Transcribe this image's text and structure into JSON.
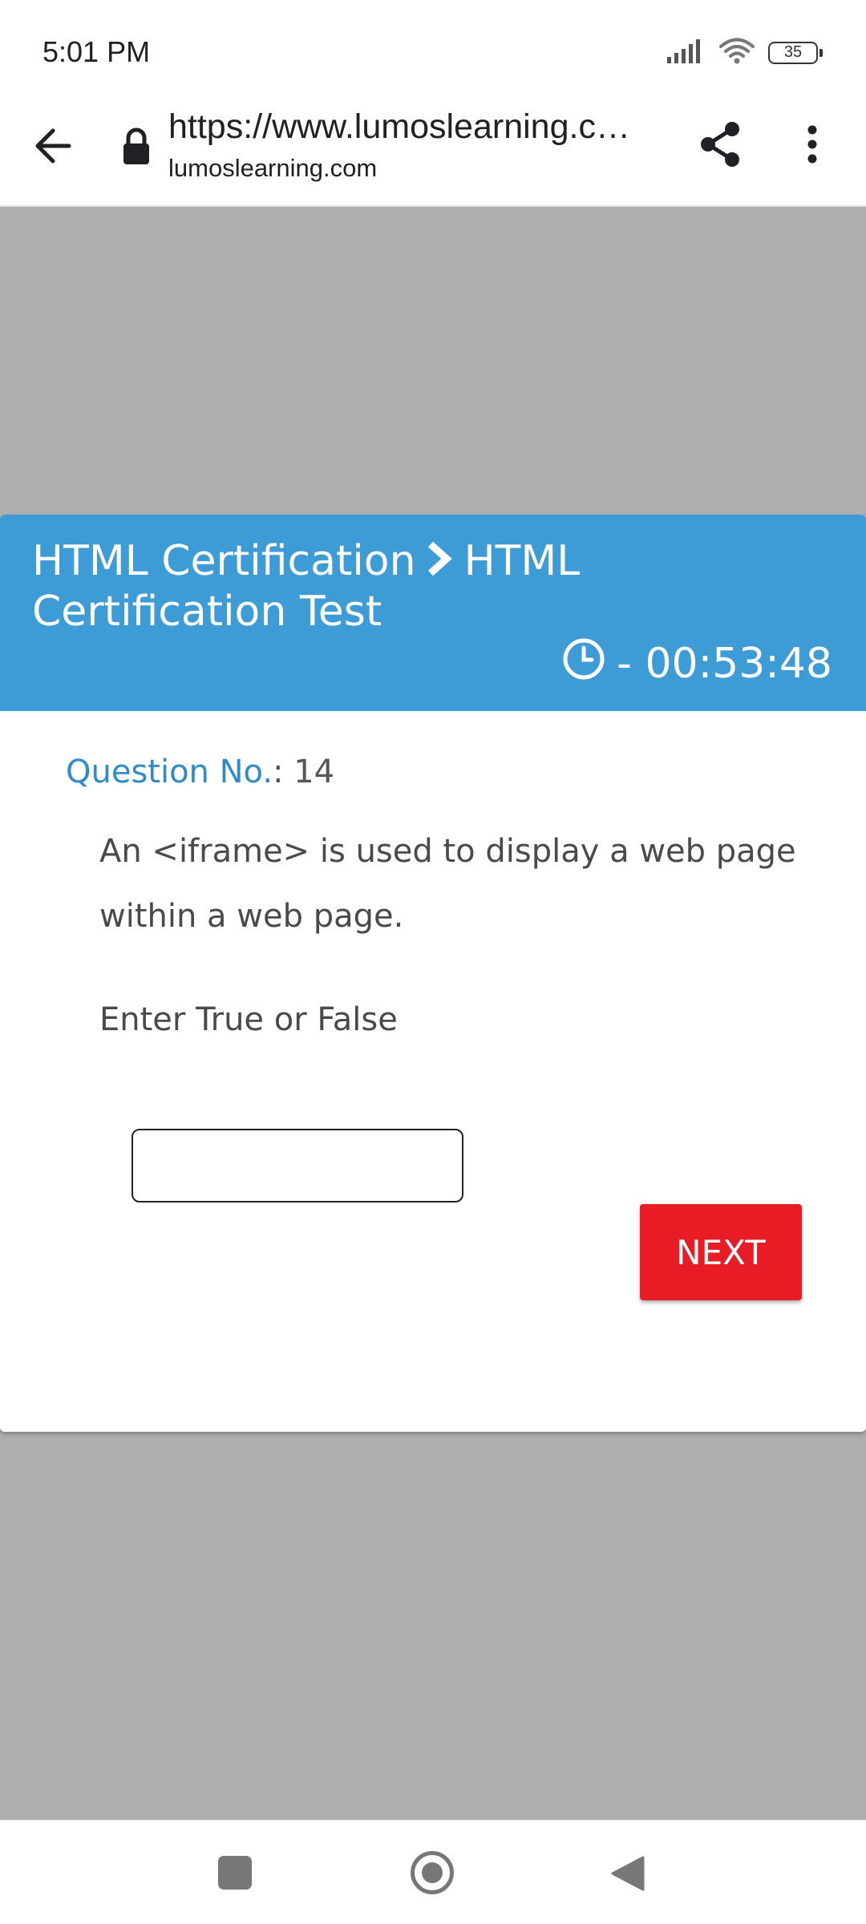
{
  "status_bar": {
    "time": "5:01 PM",
    "battery": "35"
  },
  "browser": {
    "url": "https://www.lumoslearning.c…",
    "domain": "lumoslearning.com"
  },
  "header": {
    "breadcrumb": [
      "HTML Certification",
      "HTML Certification Test"
    ],
    "timer": "- 00:53:48"
  },
  "question": {
    "number_label": "Question No.",
    "number_sep": ": ",
    "number": "14",
    "text": "An <iframe> is used to display a web page within a web page.",
    "instruction": "Enter True or False",
    "answer_value": "",
    "next_label": "NEXT"
  },
  "colors": {
    "header_bg": "#3d9bd6",
    "next_button": "#e81c24",
    "question_label": "#2f8cc9",
    "page_bg": "#afafaf"
  }
}
